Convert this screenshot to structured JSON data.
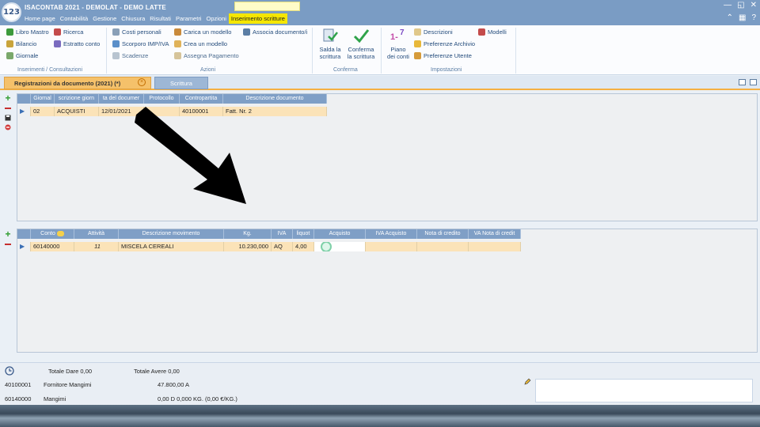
{
  "app": {
    "logo_text": "123",
    "title": "ISACONTAB 2021 - DEMOLAT - DEMO LATTE",
    "menu": [
      "Home page",
      "Contabilità",
      "Gestione",
      "Chiusura",
      "Risultati",
      "Parametri",
      "Opzioni",
      "Inserimento scritture"
    ],
    "active_menu_index": 7,
    "window_controls": [
      "—",
      "◱",
      "✕"
    ],
    "window_controls_2": [
      "⌃",
      "▦",
      "?"
    ]
  },
  "ribbon": {
    "group1": {
      "items": [
        "Libro Mastro",
        "Ricerca",
        "Bilancio",
        "Estratto conto",
        "Giornale"
      ],
      "label": "Inserimenti / Consultazioni"
    },
    "group2": {
      "items": [
        "Costi personali",
        "Carica un modello",
        "Associa documento/i",
        "Scorporo IMP/IVA",
        "Crea un modello",
        "Scadenze",
        "Assegna Pagamento"
      ],
      "label": "Azioni"
    },
    "group3": {
      "buttons": [
        {
          "line1": "Salda la",
          "line2": "scrittura"
        },
        {
          "line1": "Conferma",
          "line2": "la scrittura"
        }
      ],
      "label": "Conferma"
    },
    "group4": {
      "big_button": {
        "line1": "Piano",
        "line2": "dei conti"
      },
      "items": [
        "Descrizioni",
        "Modelli",
        "Preferenze Archivio",
        "Preferenze Utente"
      ],
      "label": "Impostazioni"
    }
  },
  "tabs": {
    "registrazioni": "Registrazioni da documento (2021) (*)",
    "scrittura": "Scrittura"
  },
  "top_grid": {
    "headers": [
      "Giornal",
      "scrizione giorn",
      "ta del documer",
      "Protocollo",
      "Contropartita",
      "Descrizione documento"
    ],
    "rows": [
      [
        "02",
        "ACQUISTI",
        "12/01/2021",
        "",
        "40100001",
        "Fatt. Nr. 2"
      ]
    ]
  },
  "bottom_grid": {
    "headers": [
      "Conto",
      "Attività",
      "Descrizione movimento",
      "Kg.",
      "IVA",
      "liquot",
      "Acquisto",
      "IVA Acquisto",
      "Nota di credito",
      "VA Nota di credit"
    ],
    "rows": [
      [
        "60140000",
        "11",
        "MISCELA CEREALI",
        "10.230,000",
        "AQ",
        "4,00",
        "",
        "",
        "",
        ""
      ]
    ]
  },
  "footer": {
    "totale_dare": "Totale Dare 0,00",
    "totale_avere": "Totale Avere 0,00",
    "lines": [
      {
        "conto": "40100001",
        "descrizione": "Fornitore Mangimi",
        "valore": "47.800,00 A"
      },
      {
        "conto": "60140000",
        "descrizione": "Mangimi",
        "valore": "0,00 D 0,000 KG. (0,00 €/KG.)"
      }
    ]
  },
  "colors": {
    "titlebar": "#7a9cc4",
    "active_menu": "#f5e600",
    "grid_header": "#7f9fc6",
    "selected_row": "#fbe3b8",
    "active_tab": "#f5c16a"
  }
}
